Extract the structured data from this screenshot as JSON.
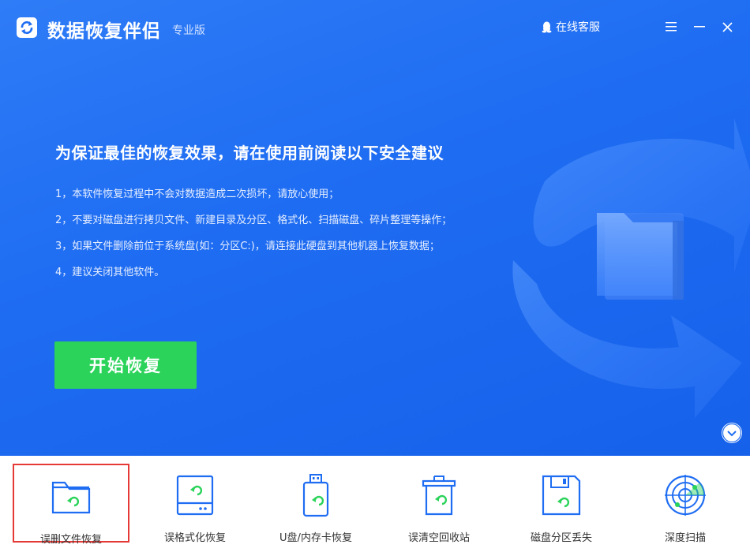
{
  "app": {
    "title": "数据恢复伴侣",
    "edition": "专业版",
    "service_label": "在线客服"
  },
  "hero": {
    "headline": "为保证最佳的恢复效果，请在使用前阅读以下安全建议",
    "tips": [
      "1，本软件恢复过程中不会对数据造成二次损坏，请放心使用；",
      "2，不要对磁盘进行拷贝文件、新建目录及分区、格式化、扫描磁盘、碎片整理等操作；",
      "3，如果文件删除前位于系统盘(如：分区C:)，请连接此硬盘到其他机器上恢复数据；",
      "4，建议关闭其他软件。"
    ],
    "start_label": "开始恢复"
  },
  "tools": [
    {
      "label": "误删文件恢复",
      "icon": "folder-recover-icon",
      "selected": true
    },
    {
      "label": "误格式化恢复",
      "icon": "drive-recover-icon",
      "selected": false
    },
    {
      "label": "U盘/内存卡恢复",
      "icon": "usb-recover-icon",
      "selected": false
    },
    {
      "label": "误清空回收站",
      "icon": "recycle-bin-recover-icon",
      "selected": false
    },
    {
      "label": "磁盘分区丢失",
      "icon": "floppy-recover-icon",
      "selected": false
    },
    {
      "label": "深度扫描",
      "icon": "radar-scan-icon",
      "selected": false
    }
  ],
  "colors": {
    "hero_blue": "#1f6df2",
    "start_green": "#2bd35a",
    "icon_blue": "#1f6df2",
    "icon_green": "#2bd35a",
    "selected_border": "#e53935"
  }
}
